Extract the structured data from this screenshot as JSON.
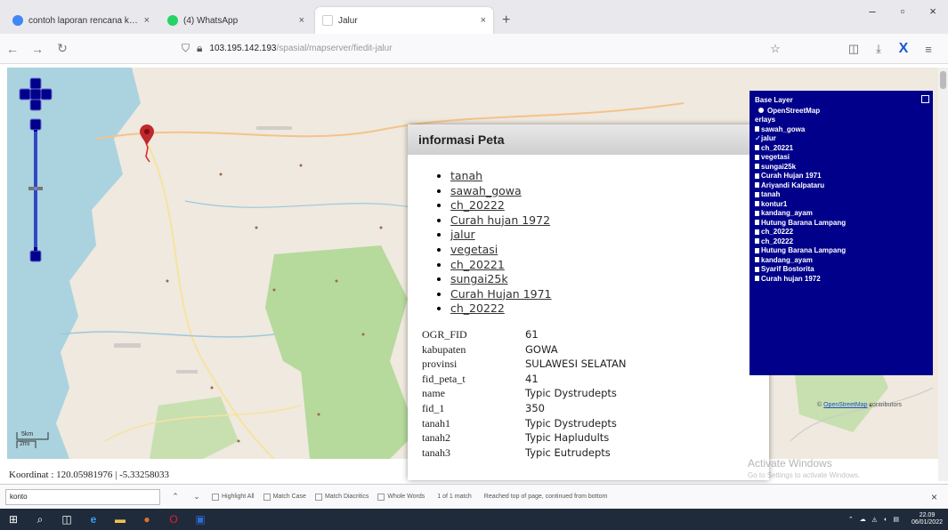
{
  "browser": {
    "tabs": [
      {
        "title": "contoh laporan rencana kerja i",
        "favicon_color": "#4285f4"
      },
      {
        "title": "(4) WhatsApp",
        "favicon_color": "#25d366"
      },
      {
        "title": "Jalur",
        "favicon_color": "#ffffff"
      }
    ],
    "url_host": "103.195.142.193",
    "url_path": "/spasial/mapserver/fiedit-jalur",
    "new_tab": "+",
    "win_min": "–",
    "win_max": "▫",
    "win_close": "×"
  },
  "map": {
    "popup": {
      "title": "informasi Peta",
      "close": "×",
      "layer_links": [
        "tanah",
        "sawah_gowa",
        "ch_20222",
        "Curah hujan 1972",
        "jalur",
        "vegetasi",
        "ch_20221",
        "sungai25k",
        "Curah Hujan 1971",
        "ch_20222"
      ],
      "attributes": [
        {
          "key": "OGR_FID",
          "value": "61"
        },
        {
          "key": "kabupaten",
          "value": "GOWA"
        },
        {
          "key": "provinsi",
          "value": "SULAWESI SELATAN"
        },
        {
          "key": "fid_peta_t",
          "value": "41"
        },
        {
          "key": "name",
          "value": "Typic Dystrudepts"
        },
        {
          "key": "fid_1",
          "value": "350"
        },
        {
          "key": "tanah1",
          "value": "Typic Dystrudepts"
        },
        {
          "key": "tanah2",
          "value": "Typic Hapludults"
        },
        {
          "key": "tanah3",
          "value": "Typic Eutrudepts"
        }
      ]
    },
    "layer_switcher": {
      "base_title": "Base Layer",
      "base_layer": "OpenStreetMap",
      "overlays_title": "erlays",
      "overlays": [
        {
          "name": "sawah_gowa",
          "checked": false
        },
        {
          "name": "jalur",
          "checked": true
        },
        {
          "name": "ch_20221",
          "checked": false
        },
        {
          "name": "vegetasi",
          "checked": false
        },
        {
          "name": "sungai25k",
          "checked": false
        },
        {
          "name": "Curah Hujan 1971",
          "checked": false
        },
        {
          "name": "Ariyandi Kalpataru",
          "checked": false
        },
        {
          "name": "tanah",
          "checked": false
        },
        {
          "name": "kontur1",
          "checked": false
        },
        {
          "name": "kandang_ayam",
          "checked": false
        },
        {
          "name": "Hutung Barana Lampang",
          "checked": false
        },
        {
          "name": "ch_20222",
          "checked": false
        },
        {
          "name": "ch_20222",
          "checked": false
        },
        {
          "name": "Hutung Barana Lampang",
          "checked": false
        },
        {
          "name": "kandang_ayam",
          "checked": false
        },
        {
          "name": "Syarif Bostorita",
          "checked": false
        },
        {
          "name": "Curah hujan 1972",
          "checked": false
        }
      ]
    },
    "attribution_link": "OpenStreetMap",
    "attribution_text": "contributors",
    "scale_top": "5km",
    "scale_bottom": "2mi",
    "coordinates": "Koordinat : 120.05981976 | -5.33258033"
  },
  "findbar": {
    "query": "konto",
    "prev": "⌃",
    "next": "⌄",
    "options": [
      "Highlight All",
      "Match Case",
      "Match Diacritics",
      "Whole Words"
    ],
    "match_status": "1 of 1 match",
    "note": "Reached top of page, continued from bottom",
    "close": "×"
  },
  "watermark": {
    "title": "Activate Windows",
    "subtitle": "Go to Settings to activate Windows."
  },
  "taskbar": {
    "time": "22.09",
    "date": "06/01/2022"
  },
  "colors": {
    "layer_bg": "#00008b",
    "map_land": "#efe9df",
    "forest": "#b6d99c",
    "sea": "#aad3df"
  }
}
